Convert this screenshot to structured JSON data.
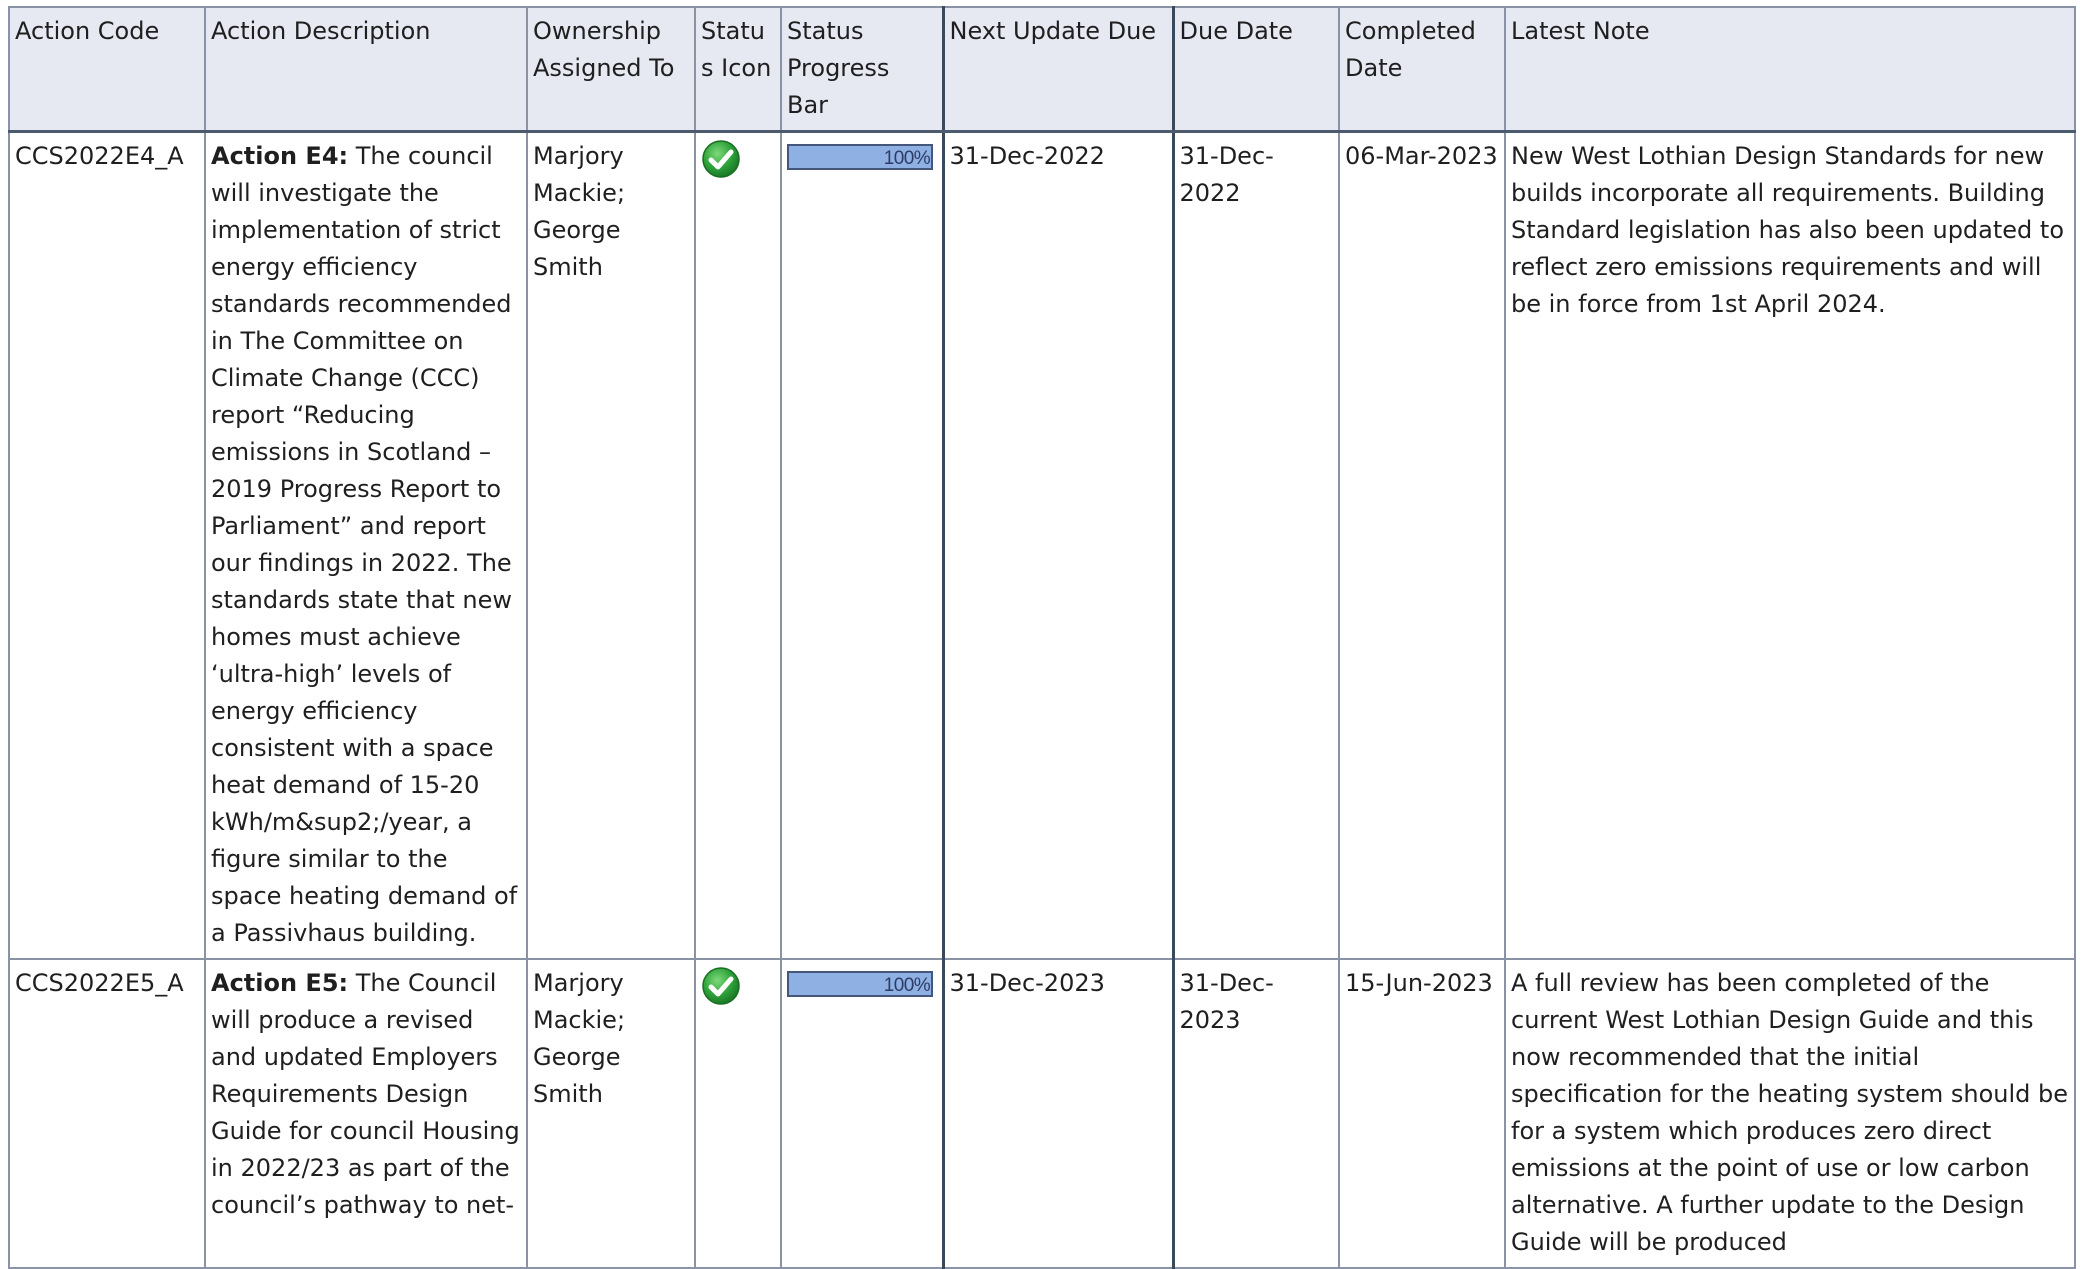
{
  "columns": {
    "action_code": "Action Code",
    "action_description": "Action Description",
    "ownership_assigned_to": "Ownership Assigned To",
    "status_icon": "Status Icon",
    "status_progress_bar": "Status Progress Bar",
    "next_update_due": "Next Update Due",
    "due_date": "Due Date",
    "completed_date": "Completed Date",
    "latest_note": "Latest Note"
  },
  "rows": [
    {
      "code": "CCS2022E4_A",
      "action_label": "Action E4:",
      "action_text": " The council will investigate the implementation of strict energy efficiency standards recommended in The Committee on Climate Change (CCC) report “Reducing emissions in Scotland – 2019 Progress Report to Parliament” and report our findings in 2022. The standards state that new homes must achieve ‘ultra-high’ levels of energy efficiency consistent with a space heat demand of 15-20 kWh/m&sup2;/year, a figure similar to the space heating demand of a Passivhaus building.",
      "owner": "Marjory Mackie; George Smith",
      "status_icon": "green-check-icon",
      "progress": 100,
      "progress_label": "100%",
      "next_update_due": "31-Dec-2022",
      "due_date": "31-Dec-2022",
      "completed_date": "06-Mar-2023",
      "latest_note": "New West Lothian Design Standards for new builds incorporate all requirements. Building Standard legislation has also been updated to reflect zero emissions requirements and will be in force from 1st April 2024."
    },
    {
      "code": "CCS2022E5_A",
      "action_label": "Action E5:",
      "action_text": " The Council will produce a revised and updated Employers Requirements Design Guide for council Housing in 2022/23 as part of the council’s pathway to net-",
      "owner": "Marjory Mackie; George Smith",
      "status_icon": "green-check-icon",
      "progress": 100,
      "progress_label": "100%",
      "next_update_due": "31-Dec-2023",
      "due_date": "31-Dec-2023",
      "completed_date": "15-Jun-2023",
      "latest_note": "A full review has been completed of the current West Lothian Design Guide and this now recommended that the initial specification for the heating system should be for a system which produces zero direct emissions at the point of use or low carbon alternative. A further update to the Design Guide will be produced"
    }
  ],
  "colors": {
    "header_bg": "#e6e8f2",
    "border": "#8a93a6",
    "progress_fill": "#8fb0e2",
    "status_green": "#2fa33b"
  }
}
